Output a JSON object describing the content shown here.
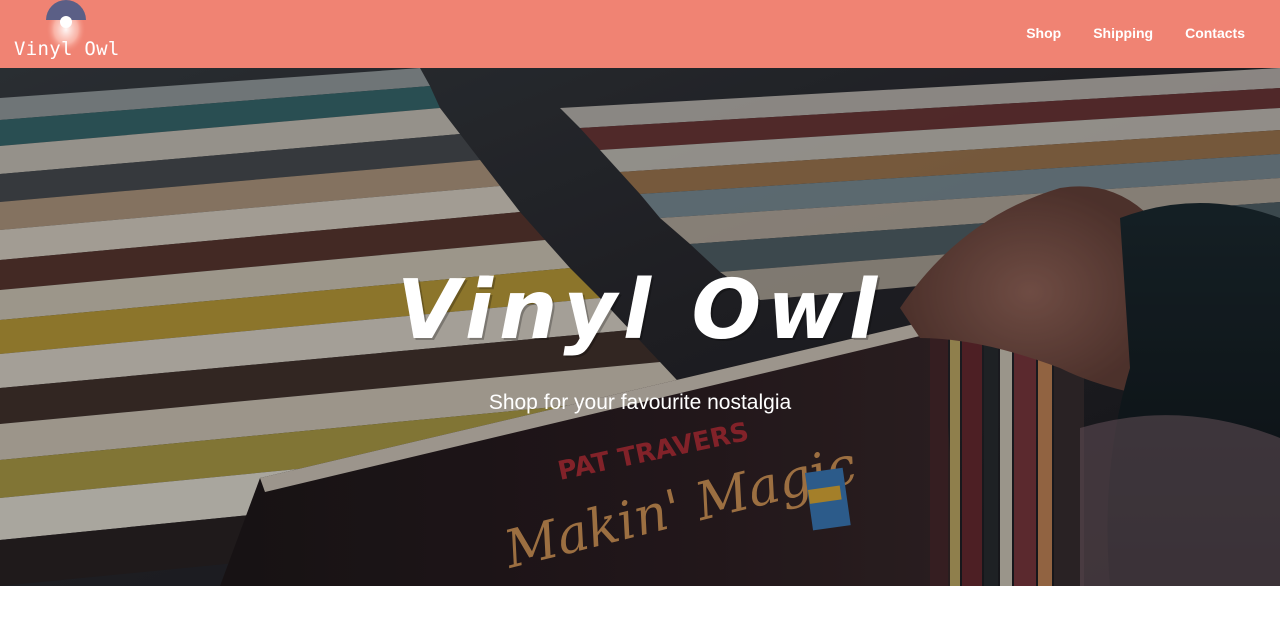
{
  "navbar": {
    "brand": "Vinyl Owl",
    "links": [
      {
        "label": "Shop"
      },
      {
        "label": "Shipping"
      },
      {
        "label": "Contacts"
      }
    ]
  },
  "hero": {
    "title": "Vinyl Owl",
    "subtitle": "Shop for your favourite nostalgia"
  },
  "colors": {
    "navbar_bg": "#f08373",
    "logo_mark": "#5b5f86",
    "text": "#ffffff"
  }
}
